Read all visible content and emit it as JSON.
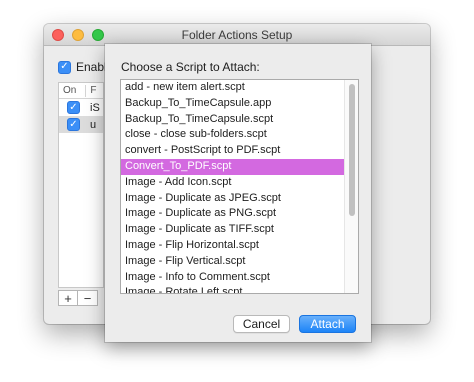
{
  "window": {
    "title": "Folder Actions Setup",
    "enable_label": "Enable",
    "enable_checked": true,
    "table": {
      "col_on": "On",
      "col_folder": "F",
      "rows": [
        {
          "checked": true,
          "label": "iS"
        },
        {
          "checked": true,
          "label": "u"
        }
      ]
    },
    "add_symbol": "+",
    "remove_symbol": "−"
  },
  "sheet": {
    "prompt": "Choose a Script to Attach:",
    "scripts": [
      "add - new item alert.scpt",
      "Backup_To_TimeCapsule.app",
      "Backup_To_TimeCapsule.scpt",
      "close - close sub-folders.scpt",
      "convert - PostScript to PDF.scpt",
      "Convert_To_PDF.scpt",
      "Image - Add Icon.scpt",
      "Image - Duplicate as JPEG.scpt",
      "Image - Duplicate as PNG.scpt",
      "Image - Duplicate as TIFF.scpt",
      "Image - Flip Horizontal.scpt",
      "Image - Flip Vertical.scpt",
      "Image - Info to Comment.scpt",
      "Image - Rotate Left.scpt"
    ],
    "selected_index": 5,
    "selection_color": "#d369e0",
    "cancel_label": "Cancel",
    "attach_label": "Attach"
  },
  "colors": {
    "accent": "#1d84f7",
    "close": "#fc605c",
    "minimize": "#fdbc40",
    "maximize": "#34c84a"
  }
}
